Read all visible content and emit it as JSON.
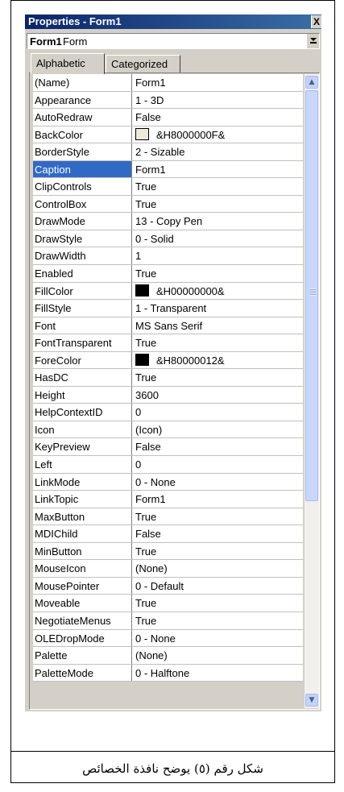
{
  "window": {
    "title": "Properties - Form1",
    "close_glyph": "X"
  },
  "object_combo": {
    "name": "Form1",
    "type": "Form"
  },
  "tabs": [
    {
      "label": "Alphabetic",
      "active": true
    },
    {
      "label": "Categorized",
      "active": false
    }
  ],
  "properties": [
    {
      "name": "(Name)",
      "value": "Form1"
    },
    {
      "name": "Appearance",
      "value": "1 - 3D"
    },
    {
      "name": "AutoRedraw",
      "value": "False"
    },
    {
      "name": "BackColor",
      "value": "&H8000000F&",
      "swatch": "#ece9d8"
    },
    {
      "name": "BorderStyle",
      "value": "2 - Sizable"
    },
    {
      "name": "Caption",
      "value": "Form1",
      "selected": true
    },
    {
      "name": "ClipControls",
      "value": "True"
    },
    {
      "name": "ControlBox",
      "value": "True"
    },
    {
      "name": "DrawMode",
      "value": "13 - Copy Pen"
    },
    {
      "name": "DrawStyle",
      "value": "0 - Solid"
    },
    {
      "name": "DrawWidth",
      "value": "1"
    },
    {
      "name": "Enabled",
      "value": "True"
    },
    {
      "name": "FillColor",
      "value": "&H00000000&",
      "swatch": "#000000"
    },
    {
      "name": "FillStyle",
      "value": "1 - Transparent"
    },
    {
      "name": "Font",
      "value": "MS Sans Serif"
    },
    {
      "name": "FontTransparent",
      "value": "True"
    },
    {
      "name": "ForeColor",
      "value": "&H80000012&",
      "swatch": "#000000"
    },
    {
      "name": "HasDC",
      "value": "True"
    },
    {
      "name": "Height",
      "value": "3600"
    },
    {
      "name": "HelpContextID",
      "value": "0"
    },
    {
      "name": "Icon",
      "value": "(Icon)"
    },
    {
      "name": "KeyPreview",
      "value": "False"
    },
    {
      "name": "Left",
      "value": "0"
    },
    {
      "name": "LinkMode",
      "value": "0 - None"
    },
    {
      "name": "LinkTopic",
      "value": "Form1"
    },
    {
      "name": "MaxButton",
      "value": "True"
    },
    {
      "name": "MDIChild",
      "value": "False"
    },
    {
      "name": "MinButton",
      "value": "True"
    },
    {
      "name": "MouseIcon",
      "value": "(None)"
    },
    {
      "name": "MousePointer",
      "value": "0 - Default"
    },
    {
      "name": "Moveable",
      "value": "True"
    },
    {
      "name": "NegotiateMenus",
      "value": "True"
    },
    {
      "name": "OLEDropMode",
      "value": "0 - None"
    },
    {
      "name": "Palette",
      "value": "(None)"
    },
    {
      "name": "PaletteMode",
      "value": "0 - Halftone"
    }
  ],
  "scrollbar": {
    "position": 0.0
  },
  "figure_caption": "شكل رقم (٥) يوضح نافذة الخصائص"
}
